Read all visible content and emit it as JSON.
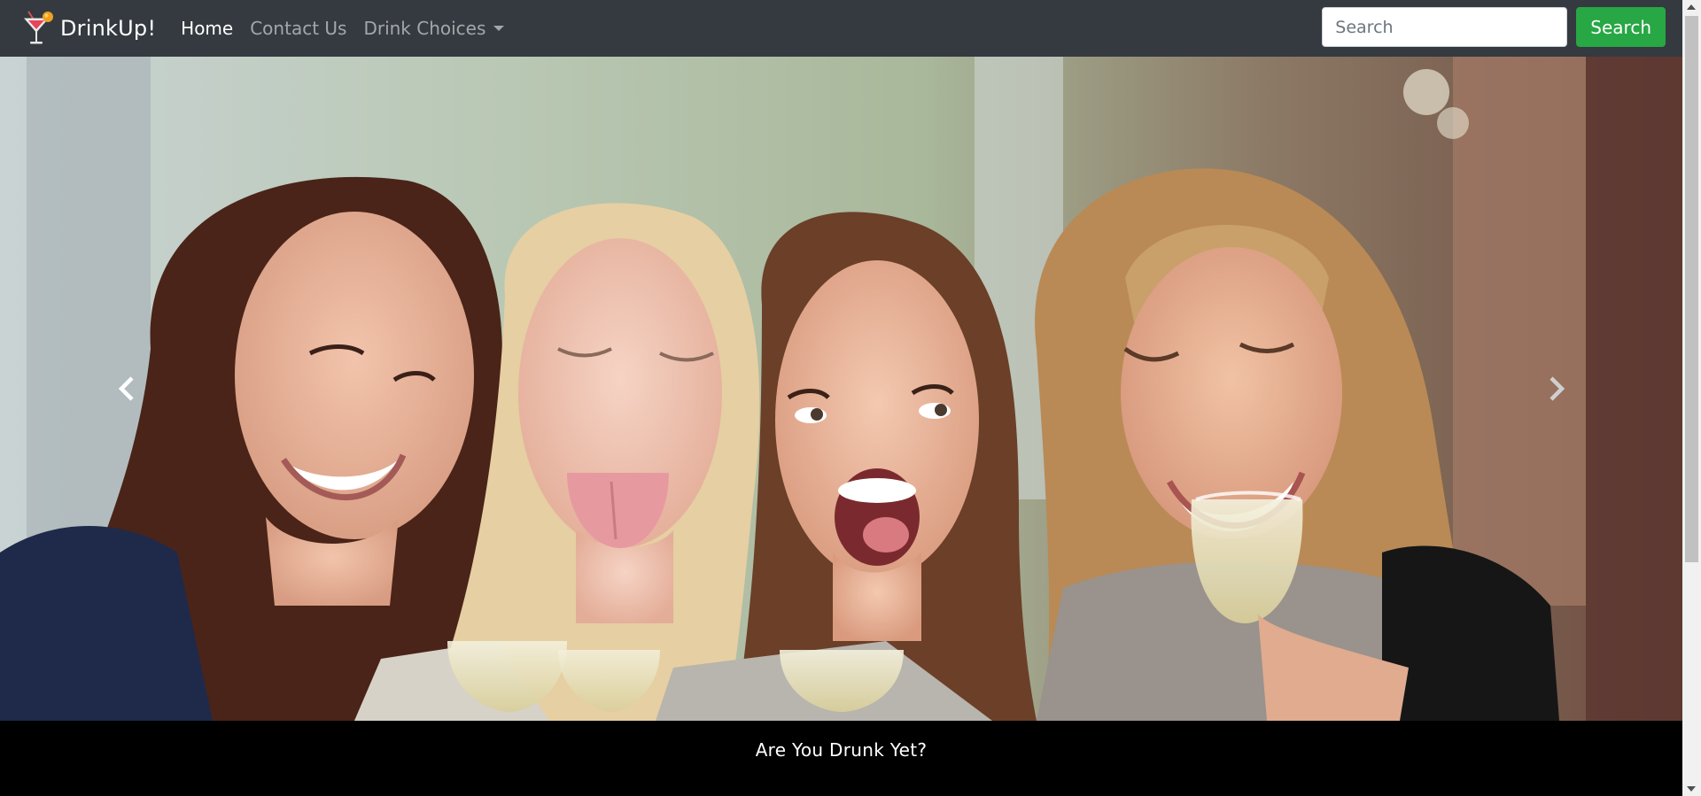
{
  "navbar": {
    "brand": "DrinkUp!",
    "links": [
      {
        "label": "Home"
      },
      {
        "label": "Contact Us"
      },
      {
        "label": "Drink Choices"
      }
    ],
    "search": {
      "placeholder": "Search",
      "button_label": "Search"
    }
  },
  "carousel": {
    "caption": "Are You Drunk Yet?"
  },
  "icons": {
    "brand": "cocktail-glass-icon",
    "prev": "chevron-left-icon",
    "next": "chevron-right-icon",
    "dropdown": "caret-down-icon"
  },
  "colors": {
    "navbar_bg": "#343a40",
    "search_button": "#28a745",
    "caption_bg": "#000000"
  }
}
